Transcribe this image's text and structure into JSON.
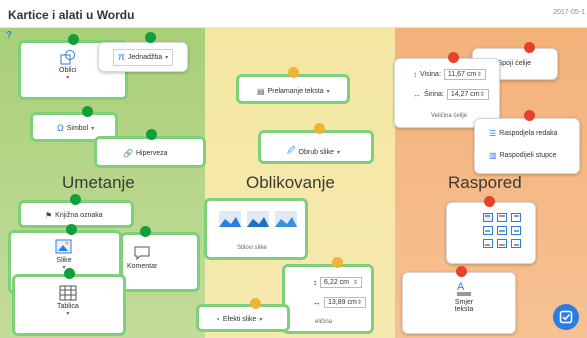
{
  "header": {
    "title": "Kartice i alati u Wordu",
    "date": "2017-05-1"
  },
  "columns": {
    "insert": "Umetanje",
    "design": "Oblikovanje",
    "layout": "Raspored"
  },
  "insert": {
    "shapes": "Oblici",
    "equation": "Jednadžba",
    "symbol": "Simbol",
    "hyperlink": "Hiperveza",
    "bookmark": "Knjižna oznaka",
    "images": "Slike",
    "comment": "Komentar",
    "table": "Tablica"
  },
  "design": {
    "wrap_text": "Prelamanje teksta",
    "picture_border": "Obrub slike",
    "picture_styles": "Stilovi slike",
    "picture_effects": "Efekti slike",
    "size_label": "eličina",
    "height_value": "6,22 cm",
    "width_value": "13,89 cm"
  },
  "layout": {
    "merge_cells": "Spoji ćelije",
    "height_label": "Visina:",
    "height_value": "11,67 cm",
    "width_label": "Širina:",
    "width_value": "14,27 cm",
    "cell_size": "Veličina ćelije",
    "distribute_rows": "Raspodjela redaka",
    "distribute_cols": "Raspodijeli stupce",
    "text_direction": "Smjer teksta"
  },
  "colors": {
    "green": "#7ed07a",
    "accent": "#2a7de1"
  }
}
